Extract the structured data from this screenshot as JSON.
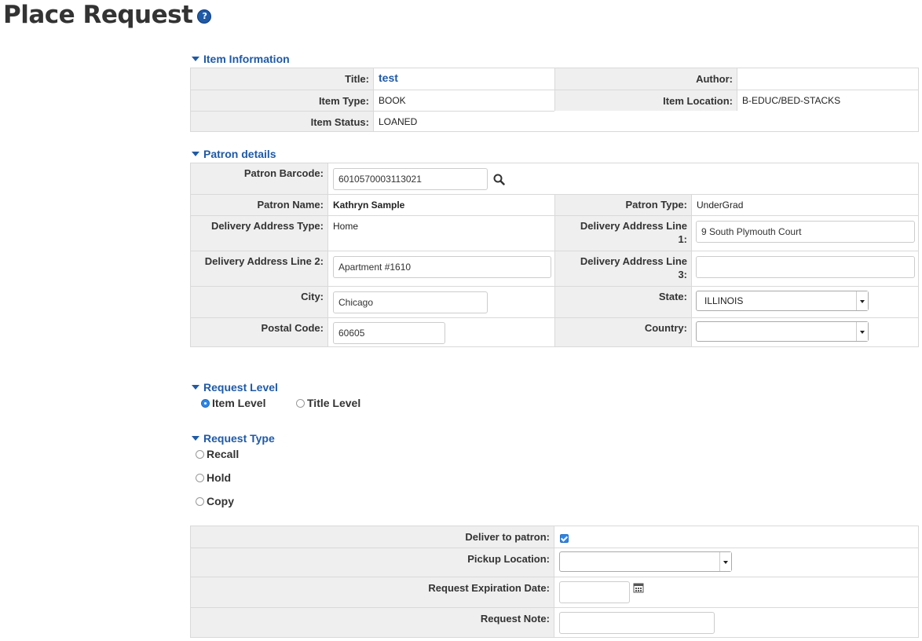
{
  "page": {
    "title": "Place Request",
    "help_icon": "?"
  },
  "item_information": {
    "header": "Item Information",
    "title_label": "Title:",
    "title_value": "test",
    "author_label": "Author:",
    "author_value": "",
    "item_type_label": "Item Type:",
    "item_type_value": "BOOK",
    "item_location_label": "Item Location:",
    "item_location_value": "B-EDUC/BED-STACKS",
    "item_status_label": "Item Status:",
    "item_status_value": "LOANED"
  },
  "patron_details": {
    "header": "Patron details",
    "barcode_label": "Patron Barcode:",
    "barcode_value": "6010570003113021",
    "name_label": "Patron Name:",
    "name_value": "Kathryn Sample",
    "type_label": "Patron Type:",
    "type_value": "UnderGrad",
    "address_type_label": "Delivery Address Type:",
    "address_type_value": "Home",
    "address_line1_label_a": "Delivery Address Line",
    "address_line1_label_b": "1:",
    "address_line1_value": "9 South Plymouth Court",
    "address_line2_label": "Delivery Address Line 2:",
    "address_line2_value": "Apartment #1610",
    "address_line3_label_a": "Delivery Address Line",
    "address_line3_label_b": "3:",
    "address_line3_value": "",
    "city_label": "City:",
    "city_value": "Chicago",
    "state_label": "State:",
    "state_value": "ILLINOIS",
    "postal_label": "Postal Code:",
    "postal_value": "60605",
    "country_label": "Country:",
    "country_value": ""
  },
  "request_level": {
    "header": "Request Level",
    "options": [
      "Item Level",
      "Title Level"
    ],
    "selected": "Item Level"
  },
  "request_type": {
    "header": "Request Type",
    "options": [
      "Recall",
      "Hold",
      "Copy"
    ],
    "selected": ""
  },
  "delivery": {
    "deliver_label": "Deliver to patron:",
    "deliver_checked": true,
    "pickup_label": "Pickup Location:",
    "pickup_value": "",
    "expiration_label": "Request Expiration Date:",
    "expiration_value": "",
    "note_label": "Request Note:",
    "note_value": ""
  },
  "colors": {
    "accent": "#1f5aa6",
    "label_bg": "#efefef",
    "checkbox": "#2d86e6"
  },
  "icons": {
    "help": "help-icon",
    "search": "search-icon",
    "calendar": "calendar-icon",
    "caret": "caret-down-icon"
  }
}
